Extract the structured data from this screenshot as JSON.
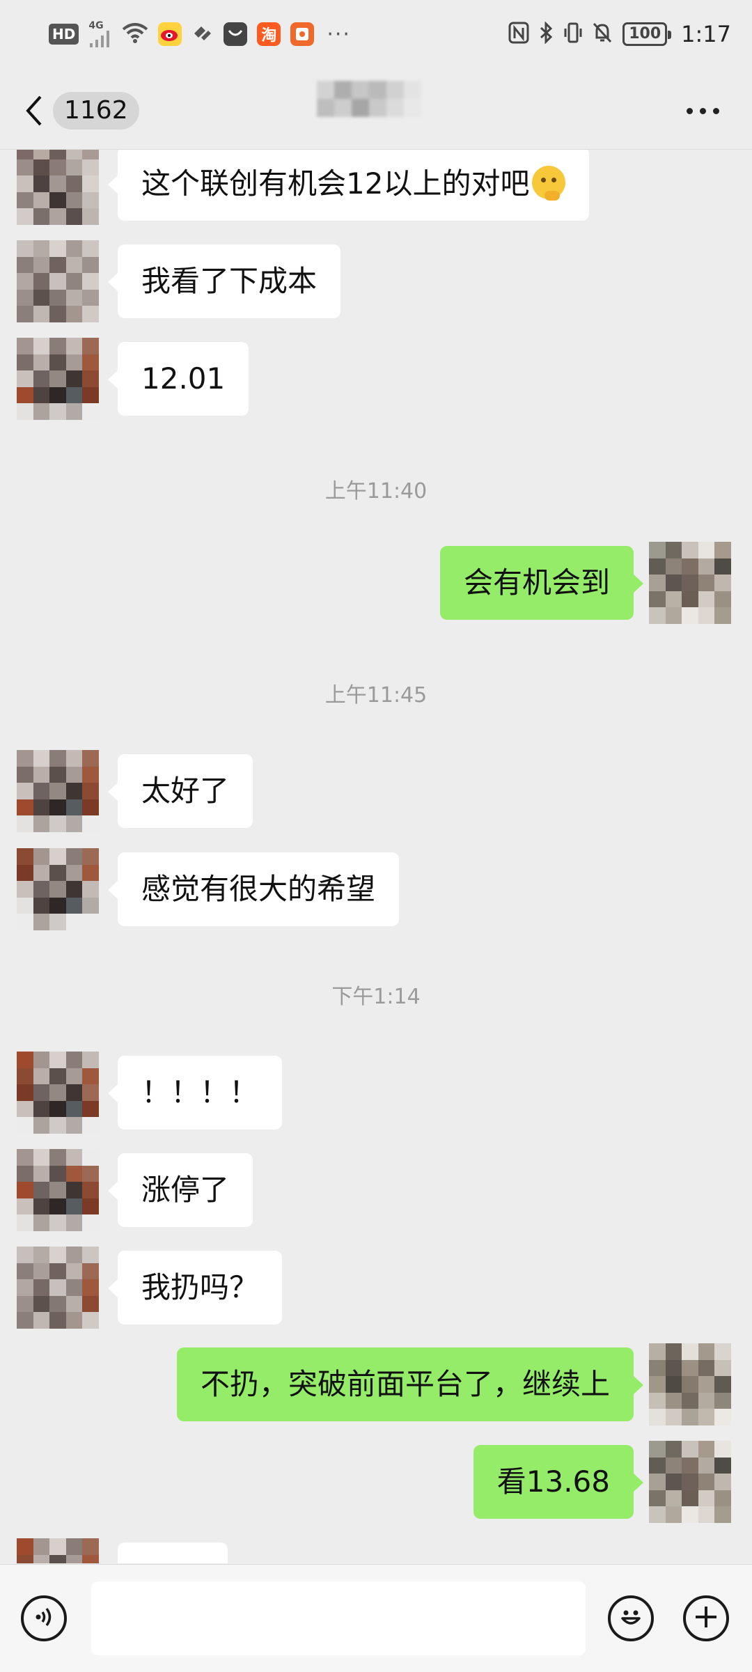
{
  "status_bar": {
    "hd_label": "HD",
    "network": "4G",
    "battery": "100",
    "time": "1:17",
    "more": "···",
    "icons": [
      "hd-icon",
      "signal-icon",
      "wifi-icon",
      "weibo-icon",
      "app-icon",
      "app-dark-icon",
      "taobao-icon",
      "red-packet-icon",
      "nfc-icon",
      "bluetooth-icon",
      "vibrate-icon",
      "mute-bell-icon",
      "battery-icon"
    ]
  },
  "nav": {
    "unread_count": "1162"
  },
  "messages": [
    {
      "id": "m1",
      "side": "in",
      "text": "这个联创有机会12以上的对吧",
      "emoji": "thinking-face-emoji"
    },
    {
      "id": "m2",
      "side": "in",
      "text": "我看了下成本"
    },
    {
      "id": "m3",
      "side": "in",
      "text": "12.01"
    },
    {
      "id": "t1",
      "type": "time",
      "text": "上午11:40"
    },
    {
      "id": "m4",
      "side": "out",
      "text": "会有机会到"
    },
    {
      "id": "t2",
      "type": "time",
      "text": "上午11:45"
    },
    {
      "id": "m5",
      "side": "in",
      "text": "太好了"
    },
    {
      "id": "m6",
      "side": "in",
      "text": "感觉有很大的希望"
    },
    {
      "id": "t3",
      "type": "time",
      "text": "下午1:14"
    },
    {
      "id": "m7",
      "side": "in",
      "text": "！！！！"
    },
    {
      "id": "m8",
      "side": "in",
      "text": "涨停了"
    },
    {
      "id": "m9",
      "side": "in",
      "text": "我扔吗？"
    },
    {
      "id": "m10",
      "side": "out",
      "text": "不扔，突破前面平台了，继续上"
    },
    {
      "id": "m11",
      "side": "out",
      "text": "看13.68"
    },
    {
      "id": "m12",
      "side": "in",
      "text": ""
    }
  ],
  "input_bar": {
    "value": "",
    "placeholder": ""
  },
  "colors": {
    "background": "#ededed",
    "incoming_bubble": "#ffffff",
    "outgoing_bubble": "#95ec69",
    "timestamp": "#9a9a9a"
  }
}
